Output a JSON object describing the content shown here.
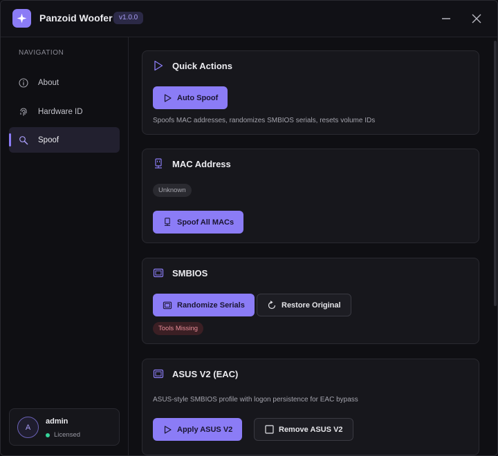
{
  "app": {
    "title": "Panzoid Woofer",
    "version": "v1.0.0",
    "accent": "#8b7cf6"
  },
  "window_controls": {
    "minimize_icon": "minus-icon",
    "close_icon": "close-icon"
  },
  "sidebar": {
    "heading": "NAVIGATION",
    "items": [
      {
        "label": "About",
        "icon": "info-icon",
        "active": false
      },
      {
        "label": "Hardware ID",
        "icon": "fingerprint-icon",
        "active": false
      },
      {
        "label": "Spoof",
        "icon": "wand-icon",
        "active": true
      }
    ],
    "user": {
      "avatar_letter": "A",
      "name": "admin",
      "status": "Licensed",
      "status_color": "#34d399"
    }
  },
  "cards": {
    "quick_actions": {
      "title": "Quick Actions",
      "button": "Auto Spoof",
      "description": "Spoofs MAC addresses, randomizes SMBIOS serials, resets volume IDs"
    },
    "mac": {
      "title": "MAC Address",
      "badge": "Unknown",
      "button": "Spoof All MACs"
    },
    "smbios": {
      "title": "SMBIOS",
      "primary_button": "Randomize Serials",
      "secondary_button": "Restore Original",
      "badge": "Tools Missing"
    },
    "asus": {
      "title": "ASUS V2 (EAC)",
      "description": "ASUS-style SMBIOS profile with logon persistence for EAC bypass",
      "primary_button": "Apply ASUS V2",
      "secondary_button": "Remove ASUS V2"
    }
  }
}
